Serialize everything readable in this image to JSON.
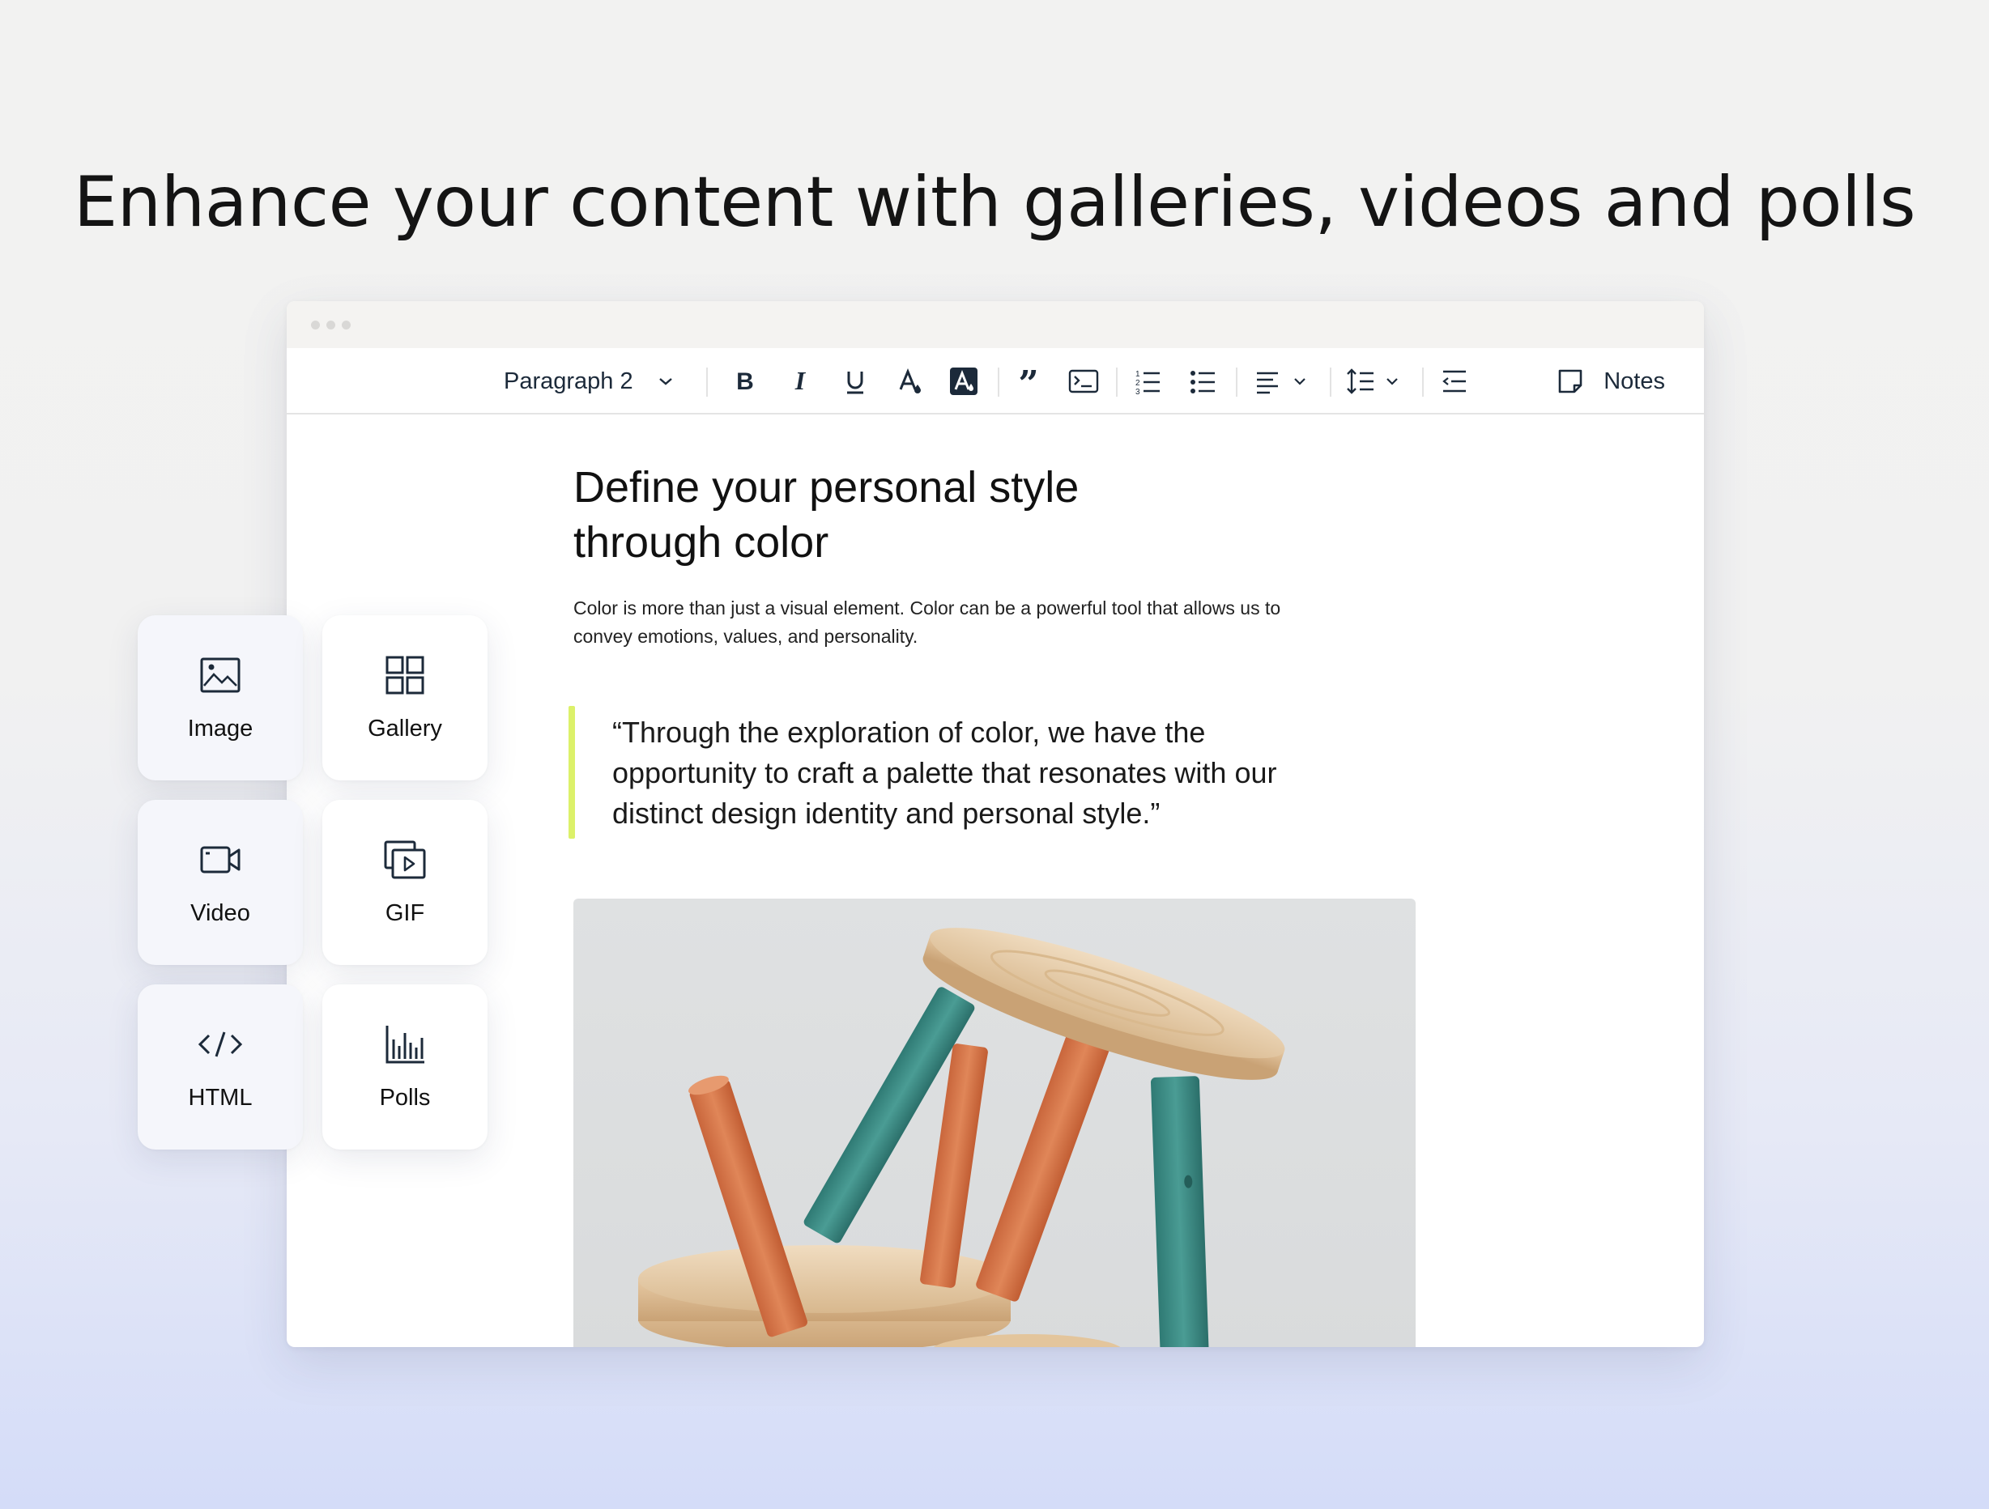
{
  "headline": "Enhance your content with galleries, videos and polls",
  "toolbar": {
    "paragraph_style": "Paragraph 2",
    "notes_label": "Notes",
    "tools": [
      "bold-icon",
      "italic-icon",
      "underline-icon",
      "text-color-icon",
      "highlight-icon",
      "quote-icon",
      "code-block-icon",
      "numbered-list-icon",
      "bulleted-list-icon",
      "align-icon",
      "line-spacing-icon",
      "indent-icon"
    ]
  },
  "document": {
    "title_line1": "Define your personal style",
    "title_line2": "through color",
    "body_line1": "Color is more than just a visual element. Color can be a powerful tool that allows us to",
    "body_line2": "convey emotions, values, and personality.",
    "quote_line1": "“Through the exploration of color, we have the",
    "quote_line2": "opportunity to craft a palette that resonates with our",
    "quote_line3": "distinct design identity and personal style.”"
  },
  "insert_panel": {
    "items": [
      {
        "label": "Image",
        "icon": "image-icon"
      },
      {
        "label": "Gallery",
        "icon": "gallery-icon"
      },
      {
        "label": "Video",
        "icon": "video-icon"
      },
      {
        "label": "GIF",
        "icon": "gif-icon"
      },
      {
        "label": "HTML",
        "icon": "html-icon"
      },
      {
        "label": "Polls",
        "icon": "polls-icon"
      }
    ]
  },
  "colors": {
    "quote_accent": "#dcf16a",
    "icon_color": "#1c2a3a",
    "orange_wood": "#d9764a",
    "teal_wood": "#3f8f88"
  }
}
